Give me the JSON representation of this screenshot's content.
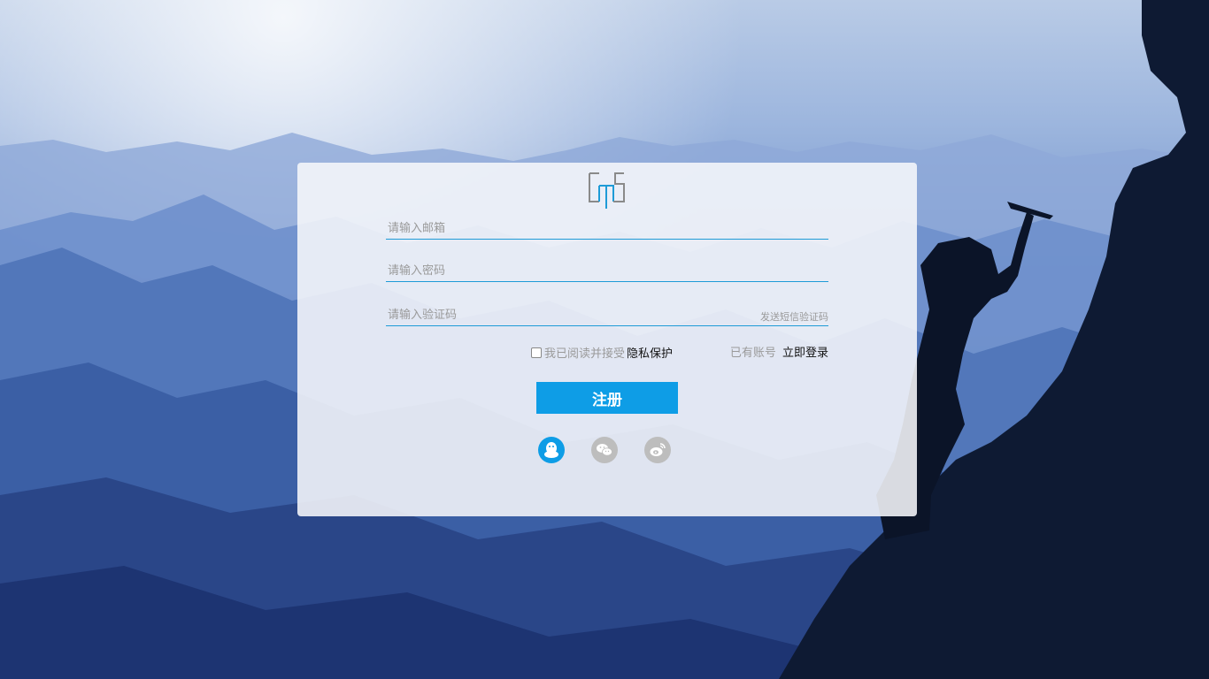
{
  "form": {
    "email_placeholder": "请输入邮箱",
    "password_placeholder": "请输入密码",
    "code_placeholder": "请输入验证码",
    "send_code_label": "发送短信验证码",
    "agree_prefix": "我已阅读并接受",
    "agree_link": "隐私保护",
    "has_account_prefix": "已有账号",
    "login_link": "立即登录",
    "register_label": "注册"
  },
  "social": {
    "items": [
      {
        "name": "qq-icon",
        "color": "#0e9de6"
      },
      {
        "name": "wechat-icon",
        "color": "#bdbdbd"
      },
      {
        "name": "weibo-icon",
        "color": "#bdbdbd"
      }
    ]
  },
  "colors": {
    "accent": "#0e9de6",
    "underline": "#1e9bd7"
  }
}
